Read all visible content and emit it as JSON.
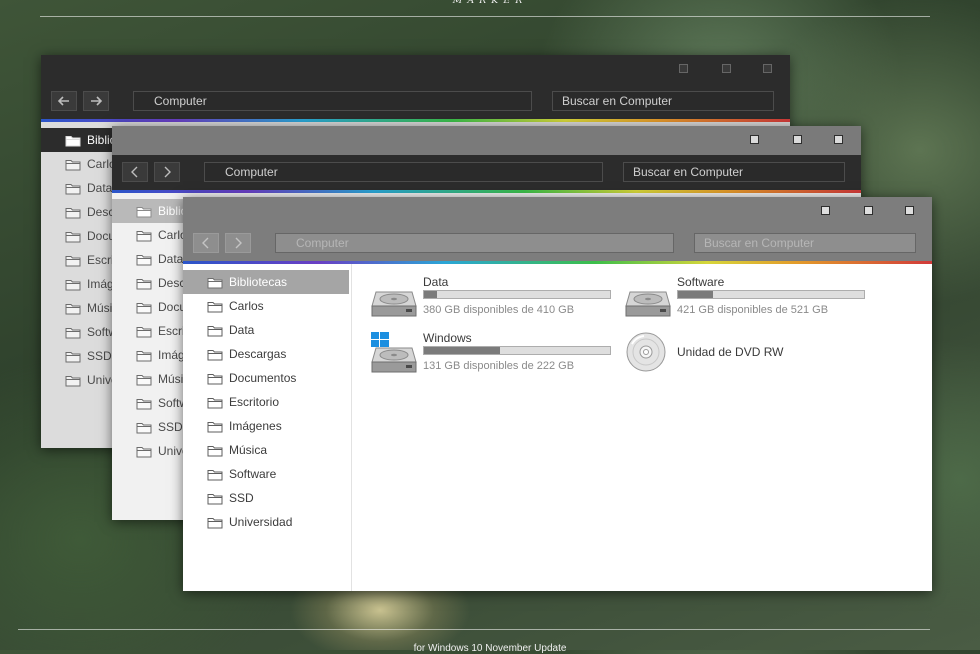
{
  "banner": {
    "title": "ᴹᴬᴿᴷᴱᴿ",
    "footer": "for Windows 10 November Update"
  },
  "explorer": {
    "address": "Computer",
    "search_placeholder": "Buscar en Computer",
    "sidebar_items": [
      "Bibliotecas",
      "Carlos",
      "Data",
      "Descargas",
      "Documentos",
      "Escritorio",
      "Imágenes",
      "Música",
      "Software",
      "SSD",
      "Universidad"
    ],
    "selected_item": "Bibliotecas"
  },
  "drives": [
    {
      "name": "Data",
      "free_text": "380 GB disponibles de 410 GB",
      "used_fraction": 0.07,
      "icon": "hard-drive-icon"
    },
    {
      "name": "Software",
      "free_text": "421 GB disponibles de 521 GB",
      "used_fraction": 0.19,
      "icon": "hard-drive-icon"
    },
    {
      "name": "Windows",
      "free_text": "131 GB disponibles de 222 GB",
      "used_fraction": 0.41,
      "icon": "windows-drive-icon"
    },
    {
      "name": "Unidad de DVD RW",
      "icon": "dvd-drive-icon"
    }
  ],
  "theme_colors": {
    "dark_chrome": "#2c2c2c",
    "gray_chrome": "#7d7d7d",
    "selected_item_dark": "#2c2c2c",
    "selected_item_gray": "#a5a5a5",
    "usage_fill": "#7b7b7b"
  }
}
